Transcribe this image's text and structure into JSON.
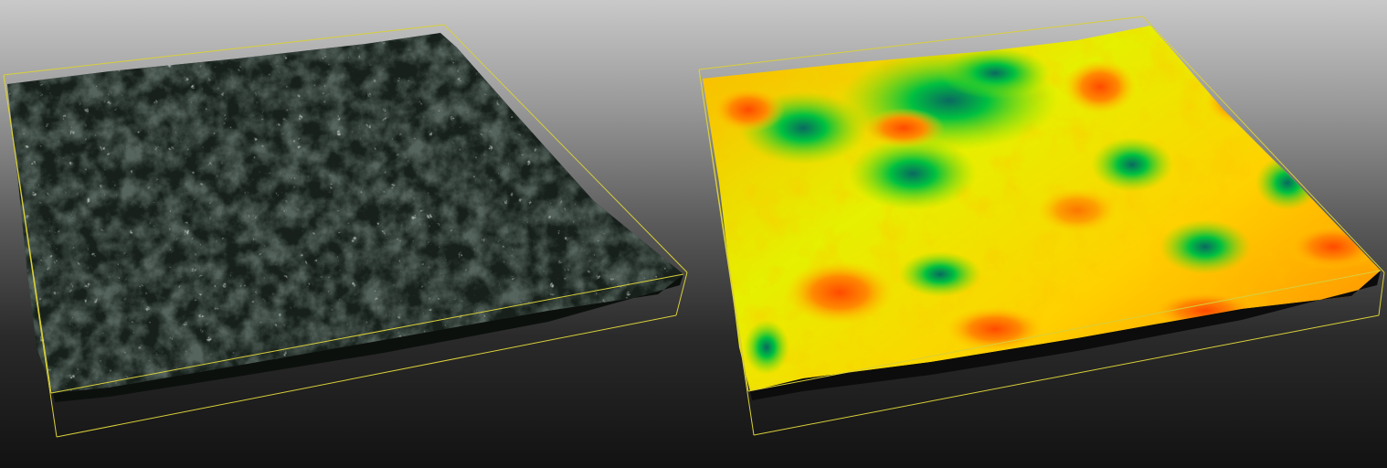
{
  "views": [
    {
      "id": "texture-view",
      "mode": "optical-texture",
      "surface_color": "#1c2620",
      "highlight_color": "#a9b8ae"
    },
    {
      "id": "height-map-view",
      "mode": "height-colormap",
      "colormap": [
        "#00aa33",
        "#7ddc00",
        "#e6f000",
        "#ffcc00",
        "#ff7a00",
        "#ff2a00"
      ]
    }
  ],
  "bounding_box_color": "#d8cf3a"
}
